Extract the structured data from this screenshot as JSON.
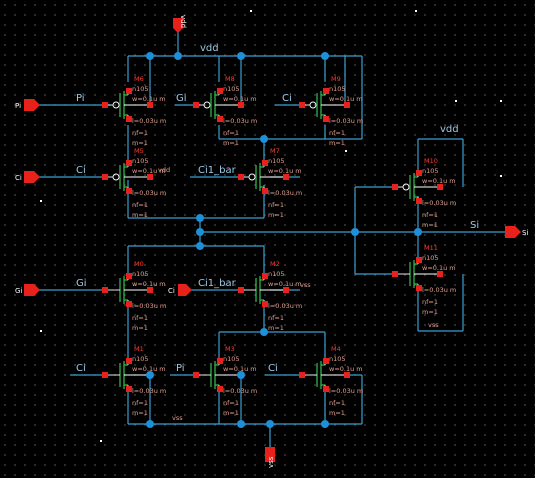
{
  "ports": {
    "vdd": "vdd",
    "vss": "vss",
    "pi": "Pi",
    "ci": "Ci",
    "gi": "Gi",
    "ci1_bar": "Ci1_bar",
    "si": "Si"
  },
  "nets": {
    "vdd_top": "vdd",
    "vdd_right": "vdd",
    "pi": "Pi",
    "gi": "Gi",
    "ci": "Ci",
    "ci1_bar": "Ci1_bar",
    "si": "Si",
    "vss_bottom": "vss",
    "vss_right": "vss",
    "vdd_m5": "vdd",
    "vss_m2": "vss"
  },
  "param_labels": {
    "n": "n105",
    "w": "w=0.1u m",
    "l": "l=0.03u m",
    "nf": "nf=1",
    "m": "m=1"
  },
  "transistors": [
    {
      "name": "M6"
    },
    {
      "name": "M8"
    },
    {
      "name": "M9"
    },
    {
      "name": "M5"
    },
    {
      "name": "M7"
    },
    {
      "name": "M10"
    },
    {
      "name": "M11"
    },
    {
      "name": "M0"
    },
    {
      "name": "M2"
    },
    {
      "name": "M1"
    },
    {
      "name": "M3"
    },
    {
      "name": "M4"
    }
  ],
  "colors": {
    "background": "#000000",
    "wire": "#3aa0d0",
    "junction": "#1e90d8",
    "pin": "#e8211b",
    "device": "#2fb34a",
    "label": "#ff3b30"
  }
}
